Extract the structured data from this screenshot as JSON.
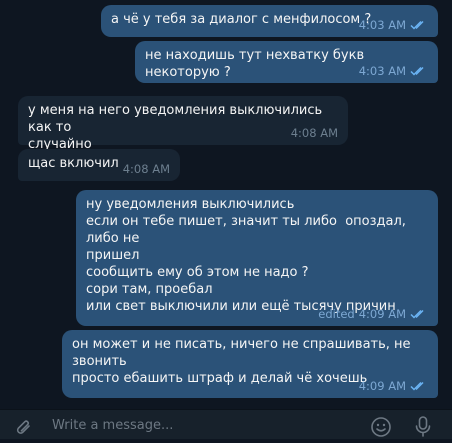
{
  "messages": [
    {
      "dir": "out",
      "text": "а чё у тебя за диалог с менфилосом ?",
      "time": "4:03 AM",
      "status": "read"
    },
    {
      "dir": "out",
      "text": "не находишь тут нехватку букв некоторую ?",
      "time": "4:03 AM",
      "status": "read"
    },
    {
      "dir": "in",
      "text": "у меня на него уведомления выключились как то\nслучайно",
      "time": "4:08 AM"
    },
    {
      "dir": "in",
      "text": "щас включил",
      "time": "4:08 AM"
    },
    {
      "dir": "out",
      "text": "ну уведомления выключились\nесли он тебе пишет, значит ты либо  опоздал, либо не\nпришел\nсообщить ему об этом не надо ?\nсори там, проебал\nили свет выключили или ещё тысячу причин",
      "edited": "edited",
      "time": "4:09 AM",
      "status": "read"
    },
    {
      "dir": "out",
      "text": "он может и не писать, ничего не спрашивать, не\nзвонить\nпросто ебашить штраф и делай чё хочешь",
      "time": "4:09 AM",
      "status": "read"
    }
  ],
  "composer": {
    "placeholder": "Write a message...",
    "attach_icon": "paperclip-icon",
    "emoji_icon": "smile-icon",
    "mic_icon": "microphone-icon"
  },
  "colors": {
    "background": "#0e1621",
    "outgoing_bubble": "#2b5278",
    "incoming_bubble": "#182533",
    "read_tick": "#7da8d3"
  }
}
